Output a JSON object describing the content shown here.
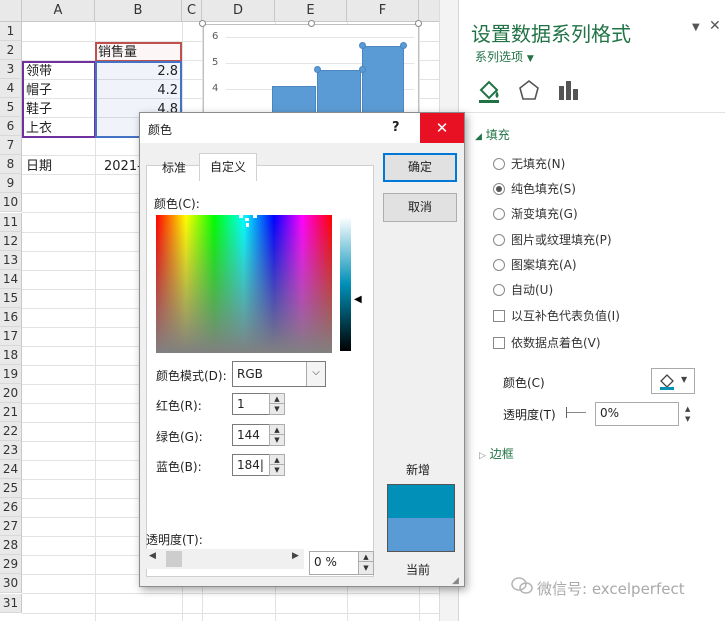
{
  "sheet": {
    "columns": [
      "A",
      "B",
      "C",
      "D",
      "E",
      "F"
    ],
    "rows": [
      "1",
      "2",
      "3",
      "4",
      "5",
      "6",
      "7",
      "8",
      "9",
      "10",
      "11",
      "12",
      "13",
      "14",
      "15",
      "16",
      "17",
      "18",
      "19",
      "20",
      "21",
      "22",
      "23",
      "24",
      "25",
      "26",
      "27",
      "28",
      "29",
      "30",
      "31"
    ],
    "header_cell": "销售量",
    "items": [
      {
        "name": "领带",
        "value": "2.8"
      },
      {
        "name": "帽子",
        "value": "4.2"
      },
      {
        "name": "鞋子",
        "value": "4.8"
      },
      {
        "name": "上衣",
        "value": ""
      }
    ],
    "date_label": "日期",
    "date_value": "2021-"
  },
  "chart": {
    "y_ticks": [
      "6",
      "5",
      "4"
    ],
    "bar_color": "#5B9BD5"
  },
  "pane": {
    "title": "设置数据系列格式",
    "series_options": "系列选项",
    "fill_section": "填充",
    "fill_options": [
      {
        "label": "无填充(N)",
        "selected": false
      },
      {
        "label": "纯色填充(S)",
        "selected": true
      },
      {
        "label": "渐变填充(G)",
        "selected": false
      },
      {
        "label": "图片或纹理填充(P)",
        "selected": false
      },
      {
        "label": "图案填充(A)",
        "selected": false
      },
      {
        "label": "自动(U)",
        "selected": false
      }
    ],
    "checkboxes": [
      "以互补色代表负值(I)",
      "依数据点着色(V)"
    ],
    "color_label": "颜色(C)",
    "transparency_label": "透明度(T)",
    "transparency_value": "0%",
    "border_section": "边框",
    "watermark": "微信号: excelperfect"
  },
  "dialog": {
    "title": "颜色",
    "help": "?",
    "close": "✕",
    "tabs": [
      "标准",
      "自定义"
    ],
    "active_tab": "自定义",
    "colors_label": "颜色(C):",
    "ok_label": "确定",
    "cancel_label": "取消",
    "mode_label": "颜色模式(D):",
    "mode_value": "RGB",
    "red_label": "红色(R):",
    "red_value": "1",
    "green_label": "绿色(G):",
    "green_value": "144",
    "blue_label": "蓝色(B):",
    "blue_value": "184",
    "new_label": "新增",
    "current_label": "当前",
    "new_color": "#0190B8",
    "current_color": "#5B9BD5",
    "transparency_label": "透明度(T):",
    "transparency_value": "0 %"
  }
}
